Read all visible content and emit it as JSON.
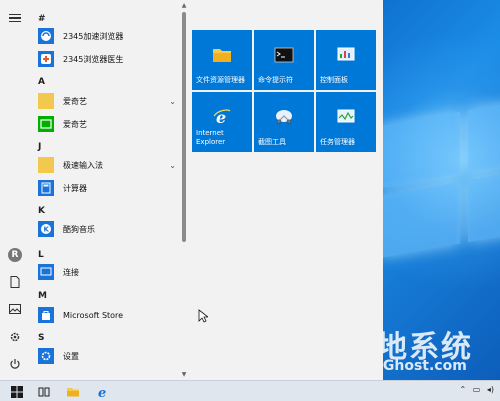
{
  "start_menu": {
    "rail": {
      "menu_icon": "hamburger-icon",
      "avatar_initial": "R",
      "document_icon": "document-icon",
      "pictures_icon": "pictures-icon",
      "settings_icon": "gear-icon",
      "power_icon": "power-icon"
    },
    "app_list": {
      "groups": [
        {
          "letter": "#",
          "apps": [
            {
              "label": "2345加速浏览器",
              "icon": "browser-2345-icon",
              "color": "#1a73d9"
            },
            {
              "label": "2345浏览器医生",
              "icon": "browser-doctor-icon",
              "color": "#1a73d9"
            }
          ]
        },
        {
          "letter": "A",
          "apps": [
            {
              "label": "爱奇艺",
              "icon": "folder-icon",
              "color": "#f2c94c",
              "expandable": true
            },
            {
              "label": "爱奇艺",
              "icon": "iqiyi-icon",
              "color": "#00b000"
            }
          ]
        },
        {
          "letter": "J",
          "apps": [
            {
              "label": "极速输入法",
              "icon": "folder-icon",
              "color": "#f2c94c",
              "expandable": true
            },
            {
              "label": "计算器",
              "icon": "calculator-icon",
              "color": "#1a73d9"
            }
          ]
        },
        {
          "letter": "K",
          "apps": [
            {
              "label": "酷狗音乐",
              "icon": "kugou-icon",
              "color": "#1a73d9"
            }
          ]
        },
        {
          "letter": "L",
          "apps": [
            {
              "label": "连接",
              "icon": "connect-icon",
              "color": "#1a73d9"
            }
          ]
        },
        {
          "letter": "M",
          "apps": [
            {
              "label": "Microsoft Store",
              "icon": "store-icon",
              "color": "#1a73d9"
            }
          ]
        },
        {
          "letter": "S",
          "apps": [
            {
              "label": "设置",
              "icon": "gear-icon",
              "color": "#1a73d9"
            }
          ]
        }
      ]
    },
    "tiles": [
      {
        "label": "文件资源管理器",
        "icon": "file-explorer-icon"
      },
      {
        "label": "命令提示符",
        "icon": "command-prompt-icon"
      },
      {
        "label": "控制面板",
        "icon": "control-panel-icon"
      },
      {
        "label_line1": "Internet",
        "label_line2": "Explorer",
        "icon": "internet-explorer-icon"
      },
      {
        "label": "截图工具",
        "icon": "snipping-tool-icon"
      },
      {
        "label": "任务管理器",
        "icon": "task-manager-icon"
      }
    ]
  },
  "taskbar": {
    "items": [
      "start-windows-icon",
      "task-view-icon",
      "file-explorer-icon",
      "edge-icon"
    ]
  },
  "watermark": {
    "title": "大地系统",
    "subtitle": "DadiGhost.com"
  },
  "colors": {
    "tile": "#0078d7",
    "menu_bg": "#f2f2f2",
    "taskbar": "#dfe6ee"
  }
}
